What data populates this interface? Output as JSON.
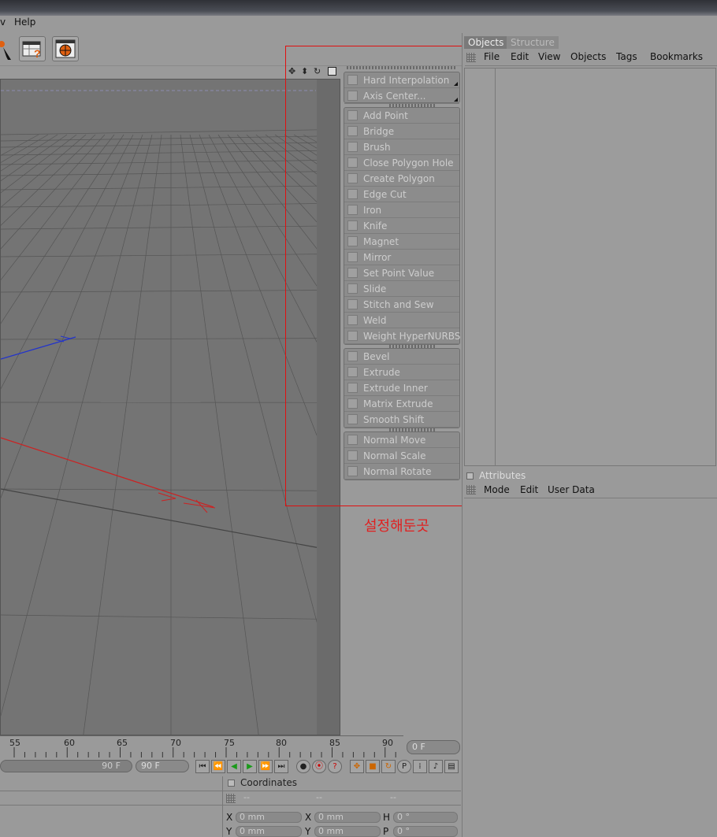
{
  "menubar": {
    "partial": "v",
    "help": "Help"
  },
  "viewport_header_icons": [
    "move-view-icon",
    "dolly-icon",
    "rotate-view-icon",
    "maximize-icon"
  ],
  "palette": {
    "group1": [
      "Hard Interpolation",
      "Axis Center..."
    ],
    "group2": [
      "Add Point",
      "Bridge",
      "Brush",
      "Close Polygon Hole",
      "Create Polygon",
      "Edge Cut",
      "Iron",
      "Knife",
      "Magnet",
      "Mirror",
      "Set Point Value",
      "Slide",
      "Stitch and Sew",
      "Weld",
      "Weight HyperNURBS"
    ],
    "group3": [
      "Bevel",
      "Extrude",
      "Extrude Inner",
      "Matrix Extrude",
      "Smooth Shift"
    ],
    "group4": [
      "Normal Move",
      "Normal Scale",
      "Normal Rotate"
    ]
  },
  "annotation": "설정해둔곳",
  "objects_panel": {
    "tabs": [
      "Objects",
      "Structure"
    ],
    "menu": [
      "File",
      "Edit",
      "View",
      "Objects",
      "Tags",
      "Bookmarks"
    ]
  },
  "attributes_panel": {
    "title": "Attributes",
    "menu": [
      "Mode",
      "Edit",
      "User Data"
    ]
  },
  "timeline": {
    "ticks": [
      "55",
      "60",
      "65",
      "70",
      "75",
      "80",
      "85",
      "90"
    ],
    "current_frame": "0 F",
    "range_end_inner": "90 F",
    "range_end": "90 F"
  },
  "coordinates": {
    "title": "Coordinates",
    "col_heads": [
      "--",
      "--",
      "--"
    ],
    "rows": [
      {
        "a": "X",
        "av": "0 mm",
        "b": "X",
        "bv": "0 mm",
        "c": "H",
        "cv": "0 °"
      },
      {
        "a": "Y",
        "av": "0 mm",
        "b": "Y",
        "bv": "0 mm",
        "c": "P",
        "cv": "0 °"
      }
    ]
  },
  "colors": {
    "accent_red": "#e01010",
    "axis_red": "#cc2222",
    "axis_blue": "#2233cc",
    "tab_active": "#c8c8c8"
  }
}
